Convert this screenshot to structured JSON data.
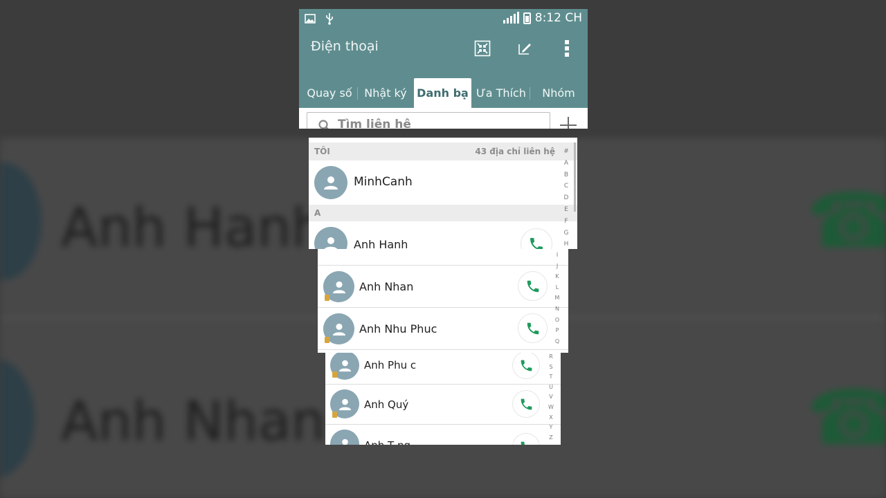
{
  "status": {
    "time": "8:12 CH",
    "icons": [
      "image-icon",
      "usb-icon",
      "signal-icon",
      "battery-icon"
    ]
  },
  "app": {
    "title": "Điện thoại",
    "actions": [
      "contract-view-icon",
      "edit-icon",
      "more-vert-icon"
    ]
  },
  "tabs": [
    {
      "label": "Quay số",
      "active": false
    },
    {
      "label": "Nhật ký",
      "active": false
    },
    {
      "label": "Danh bạ",
      "active": true
    },
    {
      "label": "Ưa Thích",
      "active": false
    },
    {
      "label": "Nhóm",
      "active": false
    }
  ],
  "search": {
    "placeholder": "Tìm liên hệ"
  },
  "me": {
    "header": "TÔI",
    "count_label": "43 địa chỉ liên hệ",
    "name": "MinhCanh"
  },
  "section_a": "A",
  "contacts": [
    {
      "name": "Anh Hanh"
    },
    {
      "name": "Anh Nhan"
    },
    {
      "name": "Anh Nhu Phuc"
    },
    {
      "name": "Anh Phu c"
    },
    {
      "name": "Anh Quý"
    },
    {
      "name": "Anh T ng"
    }
  ],
  "index_letters": [
    "#",
    "A",
    "B",
    "C",
    "D",
    "E",
    "F",
    "G",
    "H",
    "I",
    "J",
    "K",
    "L",
    "M",
    "N",
    "O",
    "P",
    "Q",
    "R",
    "S",
    "T",
    "U",
    "V",
    "W",
    "X",
    "Y",
    "Z"
  ],
  "background": {
    "text_1": "Anh Hanh",
    "text_2": "Anh Nhan"
  },
  "colors": {
    "header": "#5f8d8f",
    "avatar": "#8aa6b2",
    "call_green": "#1e9b5c",
    "sim_badge": "#d8a53c"
  }
}
